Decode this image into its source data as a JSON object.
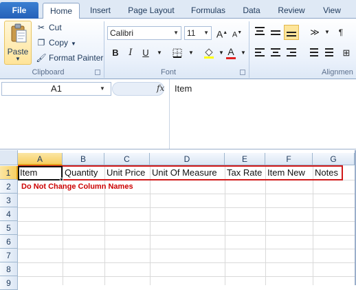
{
  "ribbon": {
    "tabs": [
      "File",
      "Home",
      "Insert",
      "Page Layout",
      "Formulas",
      "Data",
      "Review",
      "View"
    ],
    "active_tab": "Home",
    "clipboard": {
      "paste_label": "Paste",
      "cut_label": "Cut",
      "copy_label": "Copy",
      "format_painter_label": "Format Painter",
      "group_label": "Clipboard"
    },
    "font": {
      "font_name": "Calibri",
      "font_size": "11",
      "group_label": "Font",
      "bold": "B",
      "italic": "I",
      "underline": "U",
      "grow": "A",
      "shrink": "A",
      "font_color_letter": "A"
    },
    "alignment": {
      "group_label": "Alignmen"
    }
  },
  "formula_bar": {
    "name_box": "A1",
    "fx": "fx",
    "content": "Item"
  },
  "grid": {
    "columns": [
      "A",
      "B",
      "C",
      "D",
      "E",
      "F",
      "G"
    ],
    "rows": [
      "1",
      "2",
      "3",
      "4",
      "5",
      "6",
      "7",
      "8",
      "9"
    ],
    "row1": [
      "Item",
      "Quantity",
      "Unit Price",
      "Unit Of Measure",
      "Tax Rate",
      "Item New",
      "Notes"
    ],
    "active_cell": "A1",
    "note": "Do Not Change Column Names"
  },
  "colors": {
    "file_tab": "#2a6cc4",
    "highlight_border": "#d01818",
    "note_text": "#cc0000",
    "active_header": "#f7cf62"
  }
}
